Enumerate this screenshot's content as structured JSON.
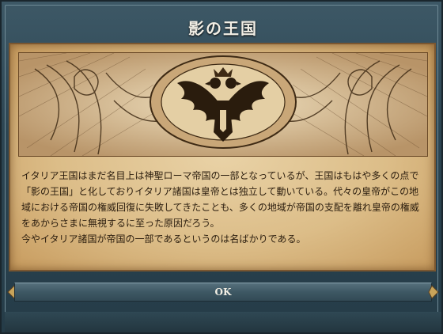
{
  "dialog": {
    "title": "影の王国",
    "body": "イタリア王国はまだ名目上は神聖ローマ帝国の一部となっているが、王国はもはや多くの点で「影の王国」と化しておりイタリア諸国は皇帝とは独立して動いている。代々の皇帝がこの地域における帝国の権威回復に失敗してきたことも、多くの地域が帝国の支配を離れ皇帝の権威をあからさまに無視するに至った原因だろう。\n今やイタリア諸国が帝国の一部であるというのは名ばかりである。",
    "ok_label": "OK"
  },
  "colors": {
    "frame": "#2c4552",
    "parchment": "#dcbd88",
    "text": "#2b1d0e",
    "title": "#f2efe6"
  },
  "illustration": {
    "subject": "double-headed-eagle-crest"
  }
}
